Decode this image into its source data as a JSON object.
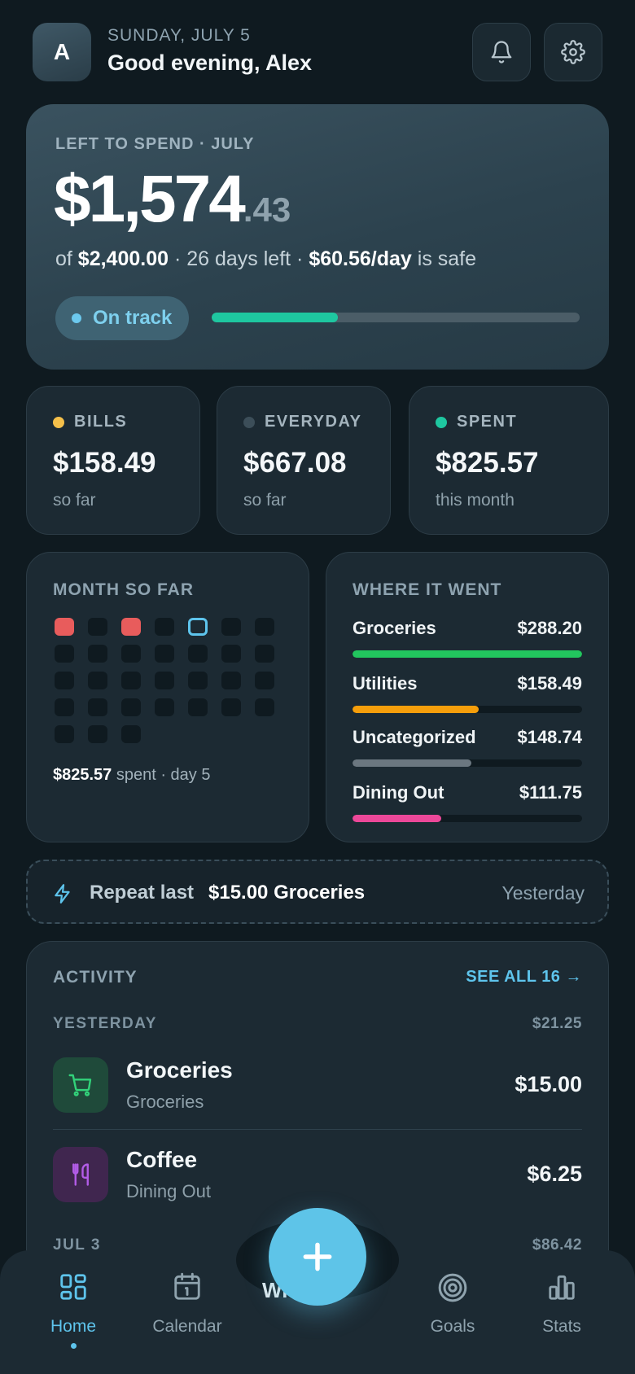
{
  "header": {
    "avatar_initial": "A",
    "date": "SUNDAY, JULY 5",
    "greeting": "Good evening, Alex"
  },
  "budget": {
    "label": "LEFT TO SPEND · JULY",
    "amount_whole": "$1,574",
    "amount_cents": ".43",
    "of_prefix": "of ",
    "total": "$2,400.00",
    "days_left": " · 26 days left · ",
    "daily_safe": "$60.56/day",
    "safe_suffix": " is safe",
    "status": "On track",
    "progress_fraction": 0.344,
    "accent_color": "#1ec7a0"
  },
  "stats": [
    {
      "label": "BILLS",
      "value": "$158.49",
      "note": "so far",
      "color": "#f5c04a"
    },
    {
      "label": "EVERYDAY",
      "value": "$667.08",
      "note": "so far",
      "color": "#3c4e59"
    },
    {
      "label": "SPENT",
      "value": "$825.57",
      "note": "this month",
      "color": "#1ec7a0"
    }
  ],
  "month": {
    "title": "MONTH SO FAR",
    "days_in_month": 31,
    "spent_days": [
      1,
      3
    ],
    "today": 5,
    "footer_amount": "$825.57",
    "footer_text": " spent · day 5"
  },
  "where": {
    "title": "WHERE IT WENT",
    "categories": [
      {
        "name": "Groceries",
        "amount": "$288.20",
        "fraction": 1.0,
        "color": "#22c55e"
      },
      {
        "name": "Utilities",
        "amount": "$158.49",
        "fraction": 0.55,
        "color": "#f59e0b"
      },
      {
        "name": "Uncategorized",
        "amount": "$148.74",
        "fraction": 0.516,
        "color": "#6b7780"
      },
      {
        "name": "Dining Out",
        "amount": "$111.75",
        "fraction": 0.388,
        "color": "#ec4899"
      }
    ]
  },
  "repeat": {
    "label": "Repeat last",
    "item": "$15.00 Groceries",
    "when": "Yesterday"
  },
  "activity": {
    "title": "ACTIVITY",
    "see_all": "SEE ALL 16 →",
    "groups": [
      {
        "label": "YESTERDAY",
        "total": "$21.25",
        "items": [
          {
            "name": "Groceries",
            "category": "Groceries",
            "amount": "$15.00",
            "icon": "cart-icon"
          },
          {
            "name": "Coffee",
            "category": "Dining Out",
            "amount": "$6.25",
            "icon": "fork-knife-icon"
          }
        ]
      },
      {
        "label": "JUL 3",
        "total": "$86.42"
      }
    ]
  },
  "nav": {
    "items": [
      {
        "label": "Home",
        "icon": "home-grid-icon",
        "active": true
      },
      {
        "label": "Calendar",
        "icon": "calendar-icon",
        "active": false
      },
      {
        "label": "Goals",
        "icon": "target-icon",
        "active": false
      },
      {
        "label": "Stats",
        "icon": "bar-chart-icon",
        "active": false
      }
    ],
    "fab_icon": "plus-icon",
    "hidden_text": "Wi      oc"
  }
}
